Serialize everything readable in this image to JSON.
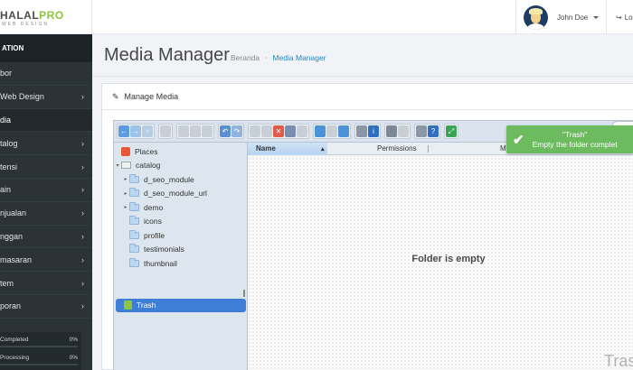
{
  "logo": {
    "brand_a": "HALAL",
    "brand_b": "PRO",
    "tagline": "WEB DESIGN"
  },
  "user": {
    "name": "John Doe",
    "logout": "Lo"
  },
  "sidebar": {
    "heading": "ATION",
    "items": [
      {
        "label": "bor",
        "has_chevron": false
      },
      {
        "label": "Web Design",
        "has_chevron": true
      },
      {
        "label": "dia",
        "has_chevron": false,
        "active": true
      },
      {
        "label": "talog",
        "has_chevron": true
      },
      {
        "label": "tensi",
        "has_chevron": true
      },
      {
        "label": "ain",
        "has_chevron": true
      },
      {
        "label": "njualan",
        "has_chevron": true
      },
      {
        "label": "nggan",
        "has_chevron": true
      },
      {
        "label": "masaran",
        "has_chevron": true
      },
      {
        "label": "tem",
        "has_chevron": true
      },
      {
        "label": "poran",
        "has_chevron": true
      }
    ],
    "stats": [
      {
        "label": "Completed",
        "value": "0%"
      },
      {
        "label": "Processing",
        "value": "0%"
      }
    ]
  },
  "page": {
    "title": "Media Manager",
    "breadcrumbs": [
      "Beranda",
      "Media Manager"
    ]
  },
  "panel": {
    "heading": "Manage Media"
  },
  "filemanager": {
    "tree": {
      "places": "Places",
      "root": "catalog",
      "folders": [
        {
          "name": "d_seo_module",
          "expandable": true
        },
        {
          "name": "d_seo_module_url",
          "expandable": true
        },
        {
          "name": "demo",
          "expandable": true
        },
        {
          "name": "icons",
          "expandable": false
        },
        {
          "name": "profile",
          "expandable": false
        },
        {
          "name": "testimonials",
          "expandable": false
        },
        {
          "name": "thumbnail",
          "expandable": false
        }
      ],
      "trash": "Trash"
    },
    "columns": {
      "name": "Name",
      "permissions": "Permissions",
      "modified": "Modifie"
    },
    "empty_message": "Folder is empty",
    "watermark": "Tras"
  },
  "toast": {
    "title": "\"Trash\"",
    "message": "Empty the folder complet"
  },
  "colors": {
    "sidebar_bg": "#2b3338",
    "accent": "#1e88c7",
    "toast": "#6cbb5f",
    "selected": "#3f7ed6"
  }
}
